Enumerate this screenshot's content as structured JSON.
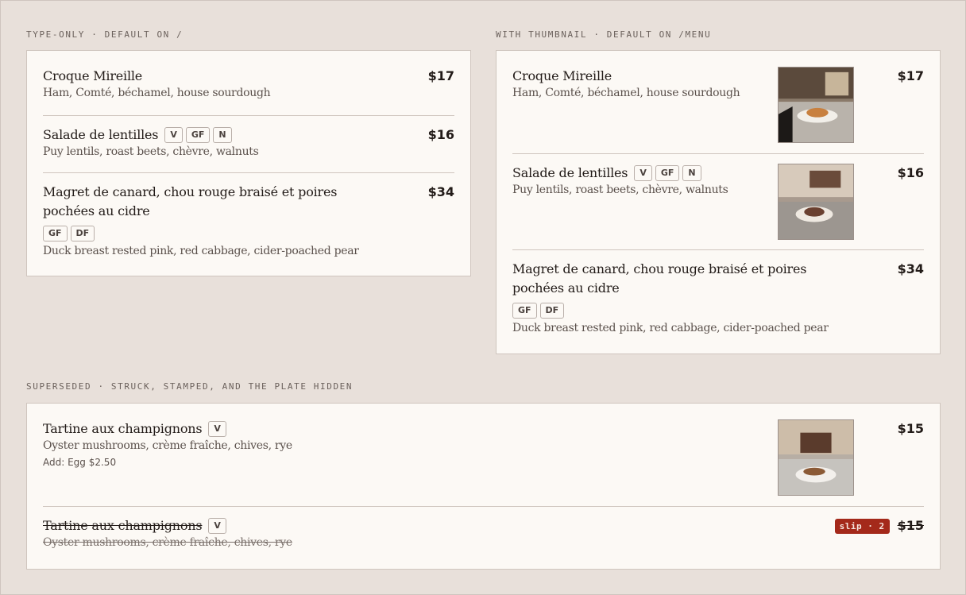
{
  "sections": {
    "type_only": {
      "label": "TYPE-ONLY · DEFAULT ON /"
    },
    "with_thumbnail": {
      "label": "WITH THUMBNAIL · DEFAULT ON /MENU"
    },
    "superseded": {
      "label": "SUPERSEDED · STRUCK, STAMPED, AND THE PLATE HIDDEN"
    }
  },
  "type_only_items": [
    {
      "title": "Croque Mireille",
      "desc": "Ham, Comté, béchamel, house sourdough",
      "price": "$17"
    },
    {
      "title": "Salade de lentilles",
      "tags": [
        "V",
        "GF",
        "N"
      ],
      "desc": "Puy lentils, roast beets, chèvre, walnuts",
      "price": "$16"
    },
    {
      "title": "Magret de canard, chou rouge braisé et poires pochées au cidre",
      "tags": [
        "GF",
        "DF"
      ],
      "desc": "Duck breast rested pink, red cabbage, cider-poached pear",
      "price": "$34"
    }
  ],
  "thumb_items": [
    {
      "title": "Croque Mireille",
      "desc": "Ham, Comté, béchamel, house sourdough",
      "price": "$17"
    },
    {
      "title": "Salade de lentilles",
      "tags": [
        "V",
        "GF",
        "N"
      ],
      "desc": "Puy lentils, roast beets, chèvre, walnuts",
      "price": "$16"
    },
    {
      "title": "Magret de canard, chou rouge braisé et poires pochées au cidre",
      "tags": [
        "GF",
        "DF"
      ],
      "desc": "Duck breast rested pink, red cabbage, cider-poached pear",
      "price": "$34"
    }
  ],
  "superseded_items": {
    "current": {
      "title": "Tartine aux champignons",
      "tags": [
        "V"
      ],
      "desc": "Oyster mushrooms, crème fraîche, chives, rye",
      "addon": "Add: Egg $2.50",
      "price": "$15"
    },
    "old": {
      "title": "Tartine aux champignons",
      "tags": [
        "V"
      ],
      "desc": "Oyster mushrooms, crème fraîche, chives, rye",
      "stamp": "slip · 2",
      "price": "$15"
    }
  },
  "colors": {
    "background": "#e8e0da",
    "card": "#fcf9f5",
    "stamp": "#a4291a"
  }
}
